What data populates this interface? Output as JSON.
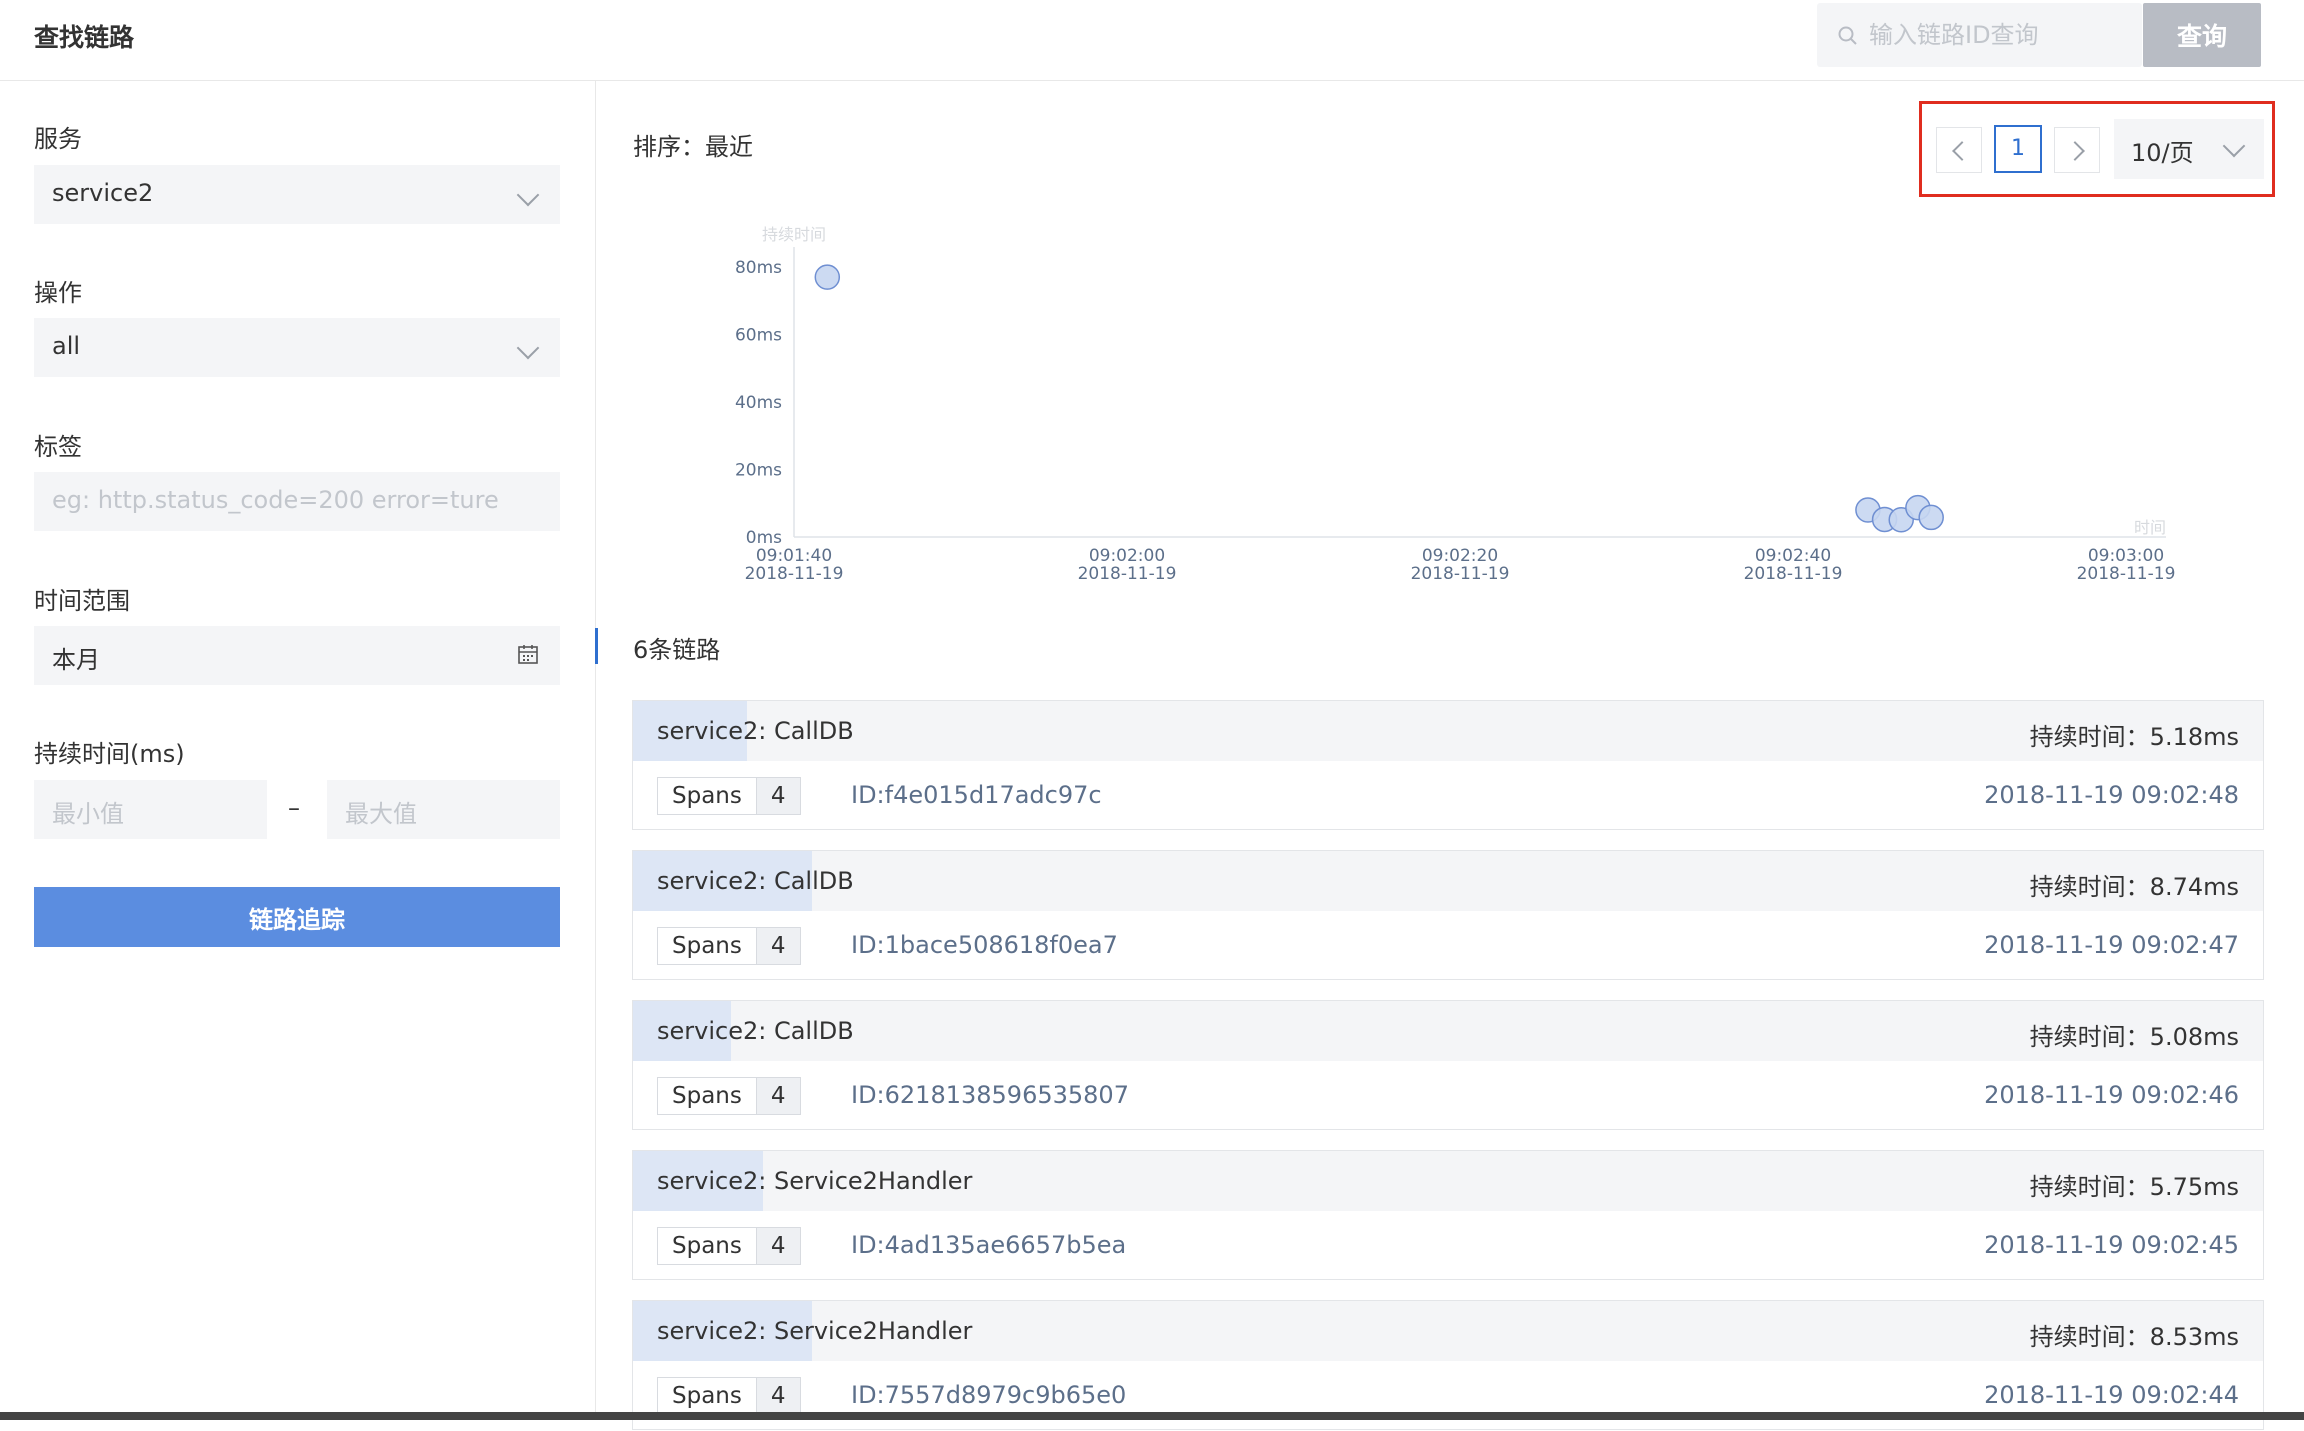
{
  "header": {
    "title": "查找链路",
    "search_placeholder": "输入链路ID查询",
    "query_label": "查询"
  },
  "sidebar": {
    "service_label": "服务",
    "service_value": "service2",
    "operation_label": "操作",
    "operation_value": "all",
    "tags_label": "标签",
    "tags_placeholder": "eg: http.status_code=200 error=ture",
    "time_range_label": "时间范围",
    "time_range_value": "本月",
    "duration_label": "持续时间(ms)",
    "min_placeholder": "最小值",
    "range_dash": "–",
    "max_placeholder": "最大值",
    "trace_button": "链路追踪"
  },
  "main": {
    "sort_label": "排序：最近",
    "count_label": "6条链路",
    "pagination": {
      "current_page": "1",
      "page_size": "10/页"
    }
  },
  "chart_data": {
    "type": "scatter",
    "ylabel": "持续时间",
    "xlabel": "时间",
    "y_ticks": [
      "0ms",
      "20ms",
      "40ms",
      "60ms",
      "80ms"
    ],
    "ylim": [
      0,
      80
    ],
    "x_ticks": [
      {
        "time": "09:01:40",
        "date": "2018-11-19",
        "seconds": 0
      },
      {
        "time": "09:02:00",
        "date": "2018-11-19",
        "seconds": 20
      },
      {
        "time": "09:02:20",
        "date": "2018-11-19",
        "seconds": 40
      },
      {
        "time": "09:02:40",
        "date": "2018-11-19",
        "seconds": 60
      },
      {
        "time": "09:03:00",
        "date": "2018-11-19",
        "seconds": 80
      }
    ],
    "xlim_seconds": [
      0,
      80
    ],
    "points": [
      {
        "t": 2,
        "y": 77
      },
      {
        "t": 64.5,
        "y": 8
      },
      {
        "t": 65.5,
        "y": 5.2
      },
      {
        "t": 66.5,
        "y": 5.1
      },
      {
        "t": 67.5,
        "y": 8.7
      },
      {
        "t": 68.3,
        "y": 5.8
      }
    ],
    "point_color": "#c7d6f1",
    "point_stroke": "#6f8fd2"
  },
  "traces": [
    {
      "name": "service2: CallDB",
      "duration": "持续时间：5.18ms",
      "spans_label": "Spans",
      "spans_count": "4",
      "id": "ID:f4e015d17adc97c",
      "time": "2018-11-19 09:02:48",
      "bar_fraction": 0.07
    },
    {
      "name": "service2: CallDB",
      "duration": "持续时间：8.74ms",
      "spans_label": "Spans",
      "spans_count": "4",
      "id": "ID:1bace508618f0ea7",
      "time": "2018-11-19 09:02:47",
      "bar_fraction": 0.11
    },
    {
      "name": "service2: CallDB",
      "duration": "持续时间：5.08ms",
      "spans_label": "Spans",
      "spans_count": "4",
      "id": "ID:6218138596535807",
      "time": "2018-11-19 09:02:46",
      "bar_fraction": 0.06
    },
    {
      "name": "service2: Service2Handler",
      "duration": "持续时间：5.75ms",
      "spans_label": "Spans",
      "spans_count": "4",
      "id": "ID:4ad135ae6657b5ea",
      "time": "2018-11-19 09:02:45",
      "bar_fraction": 0.08
    },
    {
      "name": "service2: Service2Handler",
      "duration": "持续时间：8.53ms",
      "spans_label": "Spans",
      "spans_count": "4",
      "id": "ID:7557d8979c9b65e0",
      "time": "2018-11-19 09:02:44",
      "bar_fraction": 0.11
    }
  ]
}
